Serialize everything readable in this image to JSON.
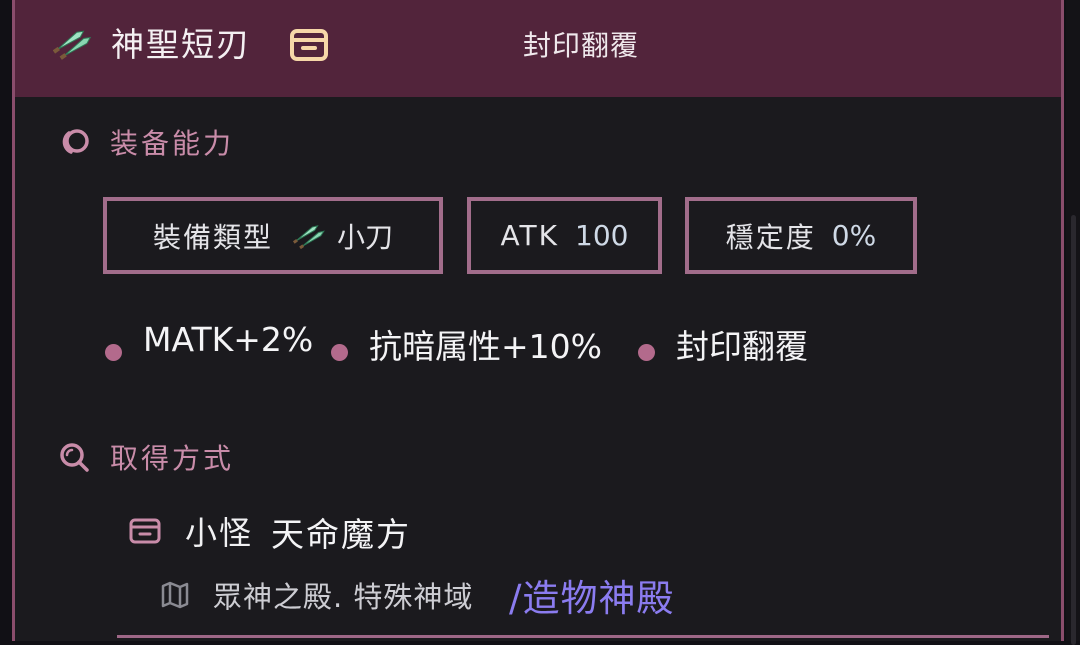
{
  "header": {
    "item_name": "神聖短刃",
    "effect_label": "封印翻覆"
  },
  "equip_section": {
    "title": "装备能力",
    "stats": [
      {
        "label": "裝備類型",
        "value": "小刀"
      },
      {
        "label": "ATK",
        "value": "100"
      },
      {
        "label": "穩定度",
        "value": "0%"
      }
    ],
    "effects": [
      "MATK+2%",
      "抗暗属性+10%",
      "封印翻覆"
    ]
  },
  "source_section": {
    "title": "取得方式",
    "source_type": "小怪",
    "source_name": "天命魔方",
    "location_text": "眾神之殿. 特殊神域",
    "location_link": "/造物神殿"
  },
  "colors": {
    "header_bg": "#52243b",
    "accent": "#a26d8b",
    "section_title": "#c98ca9",
    "link": "#8b7cf0",
    "panel_bg": "#1b1a1e"
  },
  "icons": {
    "item": "dagger-icon",
    "header_box": "item-box-icon",
    "equip": "ring-icon",
    "source": "search-icon",
    "source_type": "box-icon",
    "location": "map-icon"
  }
}
